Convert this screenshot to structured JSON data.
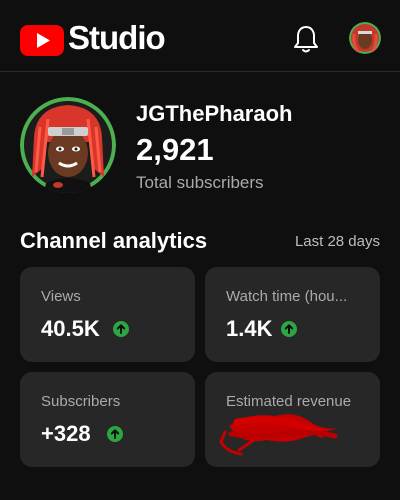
{
  "app": {
    "brand_text": "Studio",
    "logo_icon": "youtube-play-icon",
    "notifications_icon": "bell-icon",
    "account_icon": "avatar"
  },
  "colors": {
    "brand_red": "#ff0000",
    "background": "#0f0f0f",
    "card_bg": "#272727",
    "trend_up": "#2ba640",
    "secondary_text": "#aaaaaa",
    "avatar_ring": "#4caf50"
  },
  "channel": {
    "name": "JGThePharaoh",
    "subscribers": "2,921",
    "subscribers_label": "Total subscribers"
  },
  "analytics": {
    "title": "Channel analytics",
    "range": "Last 28 days",
    "cards": [
      {
        "label": "Views",
        "value": "40.5K",
        "trend": "up"
      },
      {
        "label": "Watch time (hou...",
        "value": "1.4K",
        "trend": "up"
      },
      {
        "label": "Subscribers",
        "value": "+328",
        "trend": "up"
      },
      {
        "label": "Estimated revenue",
        "value": "",
        "obscured": true
      }
    ]
  }
}
